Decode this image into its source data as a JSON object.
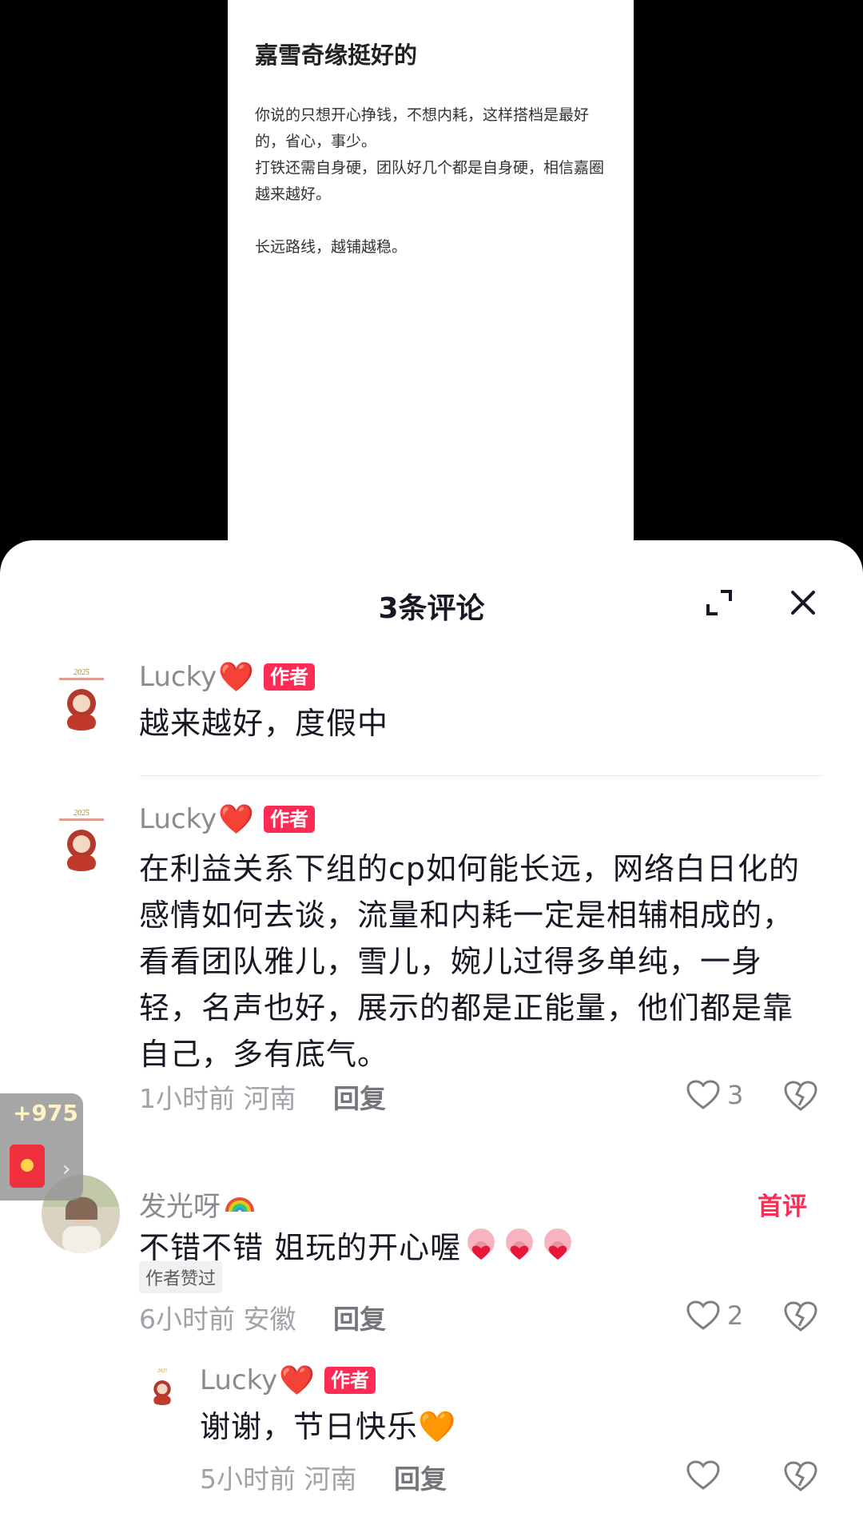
{
  "post": {
    "title": "嘉雪奇缘挺好的",
    "paragraphs": [
      "你说的只想开心挣钱，不想内耗，这样搭档是最好的，省心，事少。",
      "打铁还需自身硬，团队好几个都是自身硬，相信嘉圈越来越好。",
      "长远路线，越铺越稳。"
    ]
  },
  "sheet": {
    "title": "3条评论",
    "expand_icon": "expand-icon",
    "close_icon": "close-icon"
  },
  "comments": [
    {
      "username": "Lucky",
      "user_emoji": "❤️",
      "badge": "作者",
      "text": "越来越好，度假中"
    },
    {
      "username": "Lucky",
      "user_emoji": "❤️",
      "badge": "作者",
      "text": "在利益关系下组的cp如何能长远，网络白日化的感情如何去谈，流量和内耗一定是相辅相成的，看看团队雅儿，雪儿，婉儿过得多单纯，一身轻，名声也好，展示的都是正能量，他们都是靠自己，多有底气。",
      "time": "1小时前",
      "location": "河南",
      "reply_label": "回复",
      "likes": "3"
    },
    {
      "username": "发光呀",
      "user_emoji": "🌈",
      "first_badge": "首评",
      "text": "不错不错 姐玩的开心喔",
      "liked_tag": "作者赞过",
      "time": "6小时前",
      "location": "安徽",
      "reply_label": "回复",
      "likes": "2"
    },
    {
      "username": "Lucky",
      "user_emoji": "❤️",
      "badge": "作者",
      "text": "谢谢，节日快乐",
      "text_emoji": "🧡",
      "time": "5小时前",
      "location": "河南",
      "reply_label": "回复",
      "likes": ""
    }
  ],
  "float": {
    "count": "+975",
    "icon": "red-packet-icon"
  },
  "colors": {
    "accent": "#fe2c55",
    "text": "#161823",
    "meta": "#a1a2a7"
  }
}
